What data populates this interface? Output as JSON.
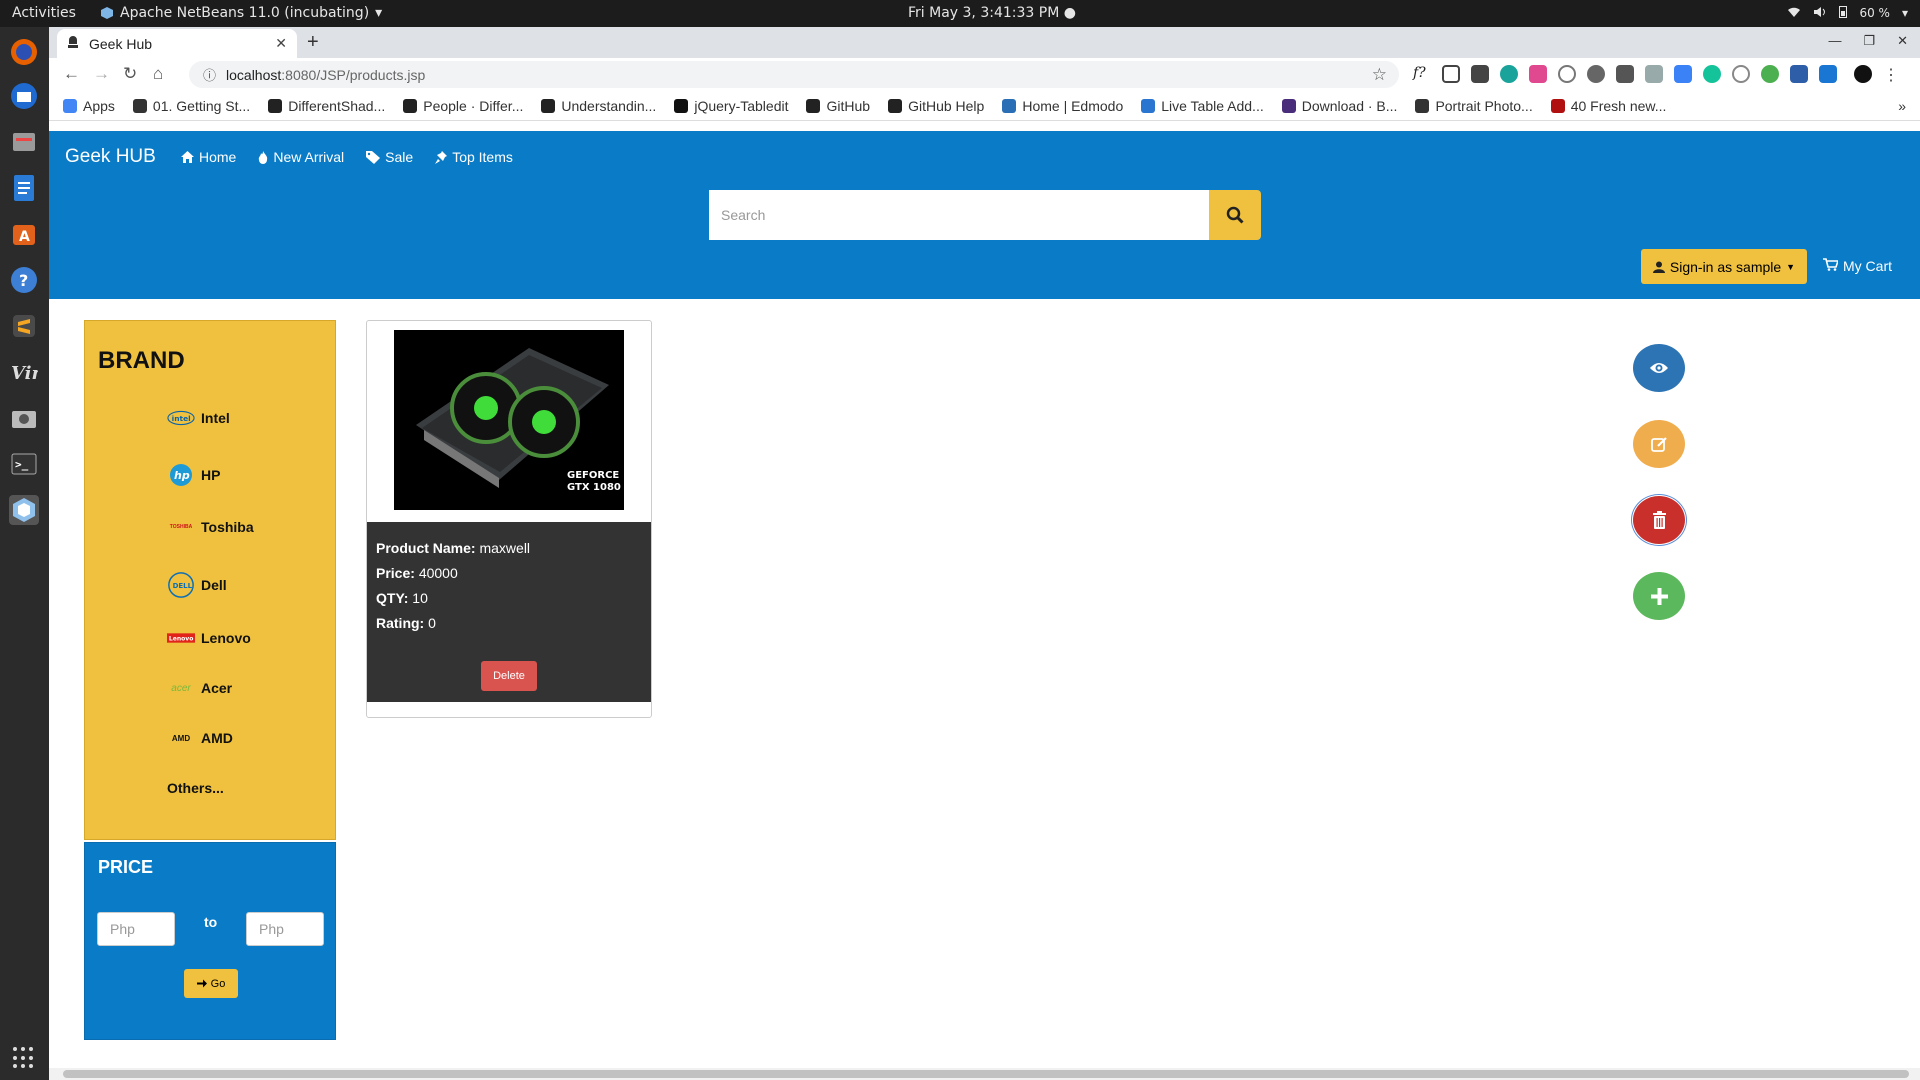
{
  "os": {
    "activities": "Activities",
    "app_menu": "Apache NetBeans 11.0 (incubating)",
    "clock": "Fri May  3,  3:41:33 PM",
    "battery": "60 %"
  },
  "browser": {
    "tab_title": "Geek Hub",
    "url_host": "localhost",
    "url_path": ":8080/JSP/products.jsp",
    "bookmarks": [
      {
        "label": "Apps",
        "color": "#4285f4"
      },
      {
        "label": "01. Getting St...",
        "color": "#333333"
      },
      {
        "label": "DifferentShad...",
        "color": "#222222"
      },
      {
        "label": "People · Differ...",
        "color": "#222222"
      },
      {
        "label": "Understandin...",
        "color": "#222222"
      },
      {
        "label": "jQuery-Tabledit",
        "color": "#111111"
      },
      {
        "label": "GitHub",
        "color": "#222222"
      },
      {
        "label": "GitHub Help",
        "color": "#222222"
      },
      {
        "label": "Home | Edmodo",
        "color": "#2a6fb5"
      },
      {
        "label": "Live Table Add...",
        "color": "#2a75d0"
      },
      {
        "label": "Download · B...",
        "color": "#4a2d7a"
      },
      {
        "label": "Portrait Photo...",
        "color": "#333333"
      },
      {
        "label": "40 Fresh new...",
        "color": "#b01010"
      }
    ]
  },
  "site": {
    "brand": "Geek HUB",
    "nav": [
      {
        "label": "Home",
        "icon": "home-icon"
      },
      {
        "label": "New Arrival",
        "icon": "fire-icon"
      },
      {
        "label": "Sale",
        "icon": "tag-icon"
      },
      {
        "label": "Top Items",
        "icon": "pushpin-icon"
      }
    ],
    "search_placeholder": "Search",
    "signin_label": "Sign-in as sample",
    "cart_label": "My Cart",
    "accent_blue": "#0a7bc6",
    "accent_yellow": "#f0c13f"
  },
  "sidebar": {
    "brand_title": "BRAND",
    "brands": [
      {
        "name": "Intel",
        "logo": "intel"
      },
      {
        "name": "HP",
        "logo": "hp"
      },
      {
        "name": "Toshiba",
        "logo": "TOSHIBA"
      },
      {
        "name": "Dell",
        "logo": "DELL"
      },
      {
        "name": "Lenovo",
        "logo": "Lenovo"
      },
      {
        "name": "Acer",
        "logo": "acer"
      },
      {
        "name": "AMD",
        "logo": "AMD"
      },
      {
        "name": "Others...",
        "logo": ""
      }
    ],
    "price_title": "PRICE",
    "price_min_placeholder": "Php",
    "price_max_placeholder": "Php",
    "price_to": "to",
    "go_label": "Go"
  },
  "product": {
    "image_caption_line1": "GEFORCE",
    "image_caption_line2": "GTX 1080",
    "name_label": "Product Name:",
    "name": "maxwell",
    "price_label": "Price:",
    "price": "40000",
    "qty_label": "QTY:",
    "qty": "10",
    "rating_label": "Rating:",
    "rating": "0",
    "delete_label": "Delete"
  },
  "fabs": [
    {
      "name": "view",
      "color": "#2d74b4",
      "icon": "eye-icon"
    },
    {
      "name": "edit",
      "color": "#f0ad4e",
      "icon": "edit-icon"
    },
    {
      "name": "delete",
      "color": "#c9302c",
      "icon": "trash-icon"
    },
    {
      "name": "add",
      "color": "#5cb85c",
      "icon": "plus-icon"
    }
  ]
}
